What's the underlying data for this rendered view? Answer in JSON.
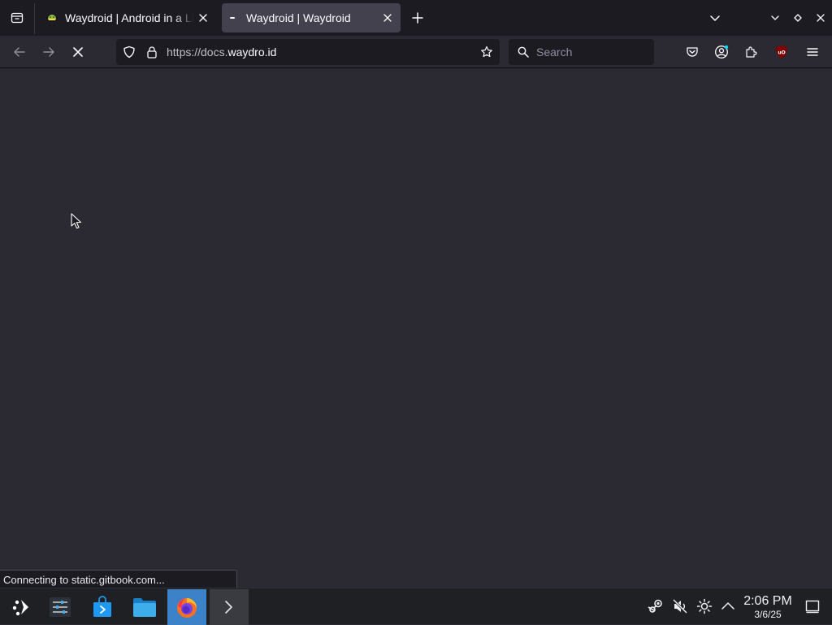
{
  "tabs": [
    {
      "title": "Waydroid | Android in a Linux container",
      "active": false
    },
    {
      "title": "Waydroid | Waydroid",
      "active": true
    }
  ],
  "navbar": {
    "url_prefix": "https://docs.",
    "url_host": "waydro.id",
    "search_placeholder": "Search"
  },
  "status_text": "Connecting to static.gitbook.com...",
  "taskbar": {
    "apps": [
      "application-launcher",
      "system-settings",
      "discover-store",
      "file-manager",
      "firefox",
      "konsole"
    ],
    "tray": [
      "steam-icon",
      "volume-muted-icon",
      "brightness-icon",
      "tray-expand-icon",
      "show-desktop-icon"
    ]
  },
  "clock": {
    "time": "2:06 PM",
    "date": "3/6/25"
  },
  "colors": {
    "toolbar": "#2b2a33",
    "tabstrip": "#1c1b22",
    "active_tab": "#42414d",
    "taskbar": "#1f2024",
    "firefox_active": "#3b82c8"
  }
}
